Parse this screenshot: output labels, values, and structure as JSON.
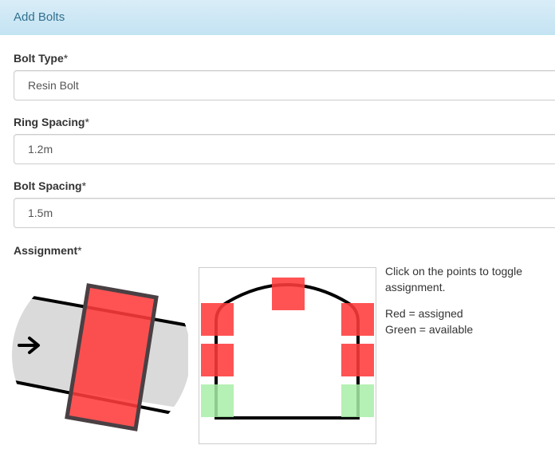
{
  "panel": {
    "title": "Add Bolts"
  },
  "form": {
    "bolt_type": {
      "label": "Bolt Type",
      "required_mark": "*",
      "value": "Resin Bolt"
    },
    "ring_spacing": {
      "label": "Ring Spacing",
      "required_mark": "*",
      "value": "1.2m"
    },
    "bolt_spacing": {
      "label": "Bolt Spacing",
      "required_mark": "*",
      "value": "1.5m"
    },
    "assignment": {
      "label": "Assignment",
      "required_mark": "*"
    }
  },
  "help": {
    "instructions": "Click on the points to toggle assignment.",
    "legend_red": "Red = assigned",
    "legend_green": "Green = available"
  },
  "colors": {
    "assigned": "#ff3b3b",
    "available": "#a8eea8",
    "tunnel_fill": "#dadada"
  },
  "icons": {
    "direction": "right-arrow-icon"
  },
  "bolt_points": [
    {
      "id": "crown",
      "state": "assigned"
    },
    {
      "id": "left-upper",
      "state": "assigned"
    },
    {
      "id": "right-upper",
      "state": "assigned"
    },
    {
      "id": "left-middle",
      "state": "assigned"
    },
    {
      "id": "right-middle",
      "state": "assigned"
    },
    {
      "id": "left-lower",
      "state": "available"
    },
    {
      "id": "right-lower",
      "state": "available"
    }
  ]
}
